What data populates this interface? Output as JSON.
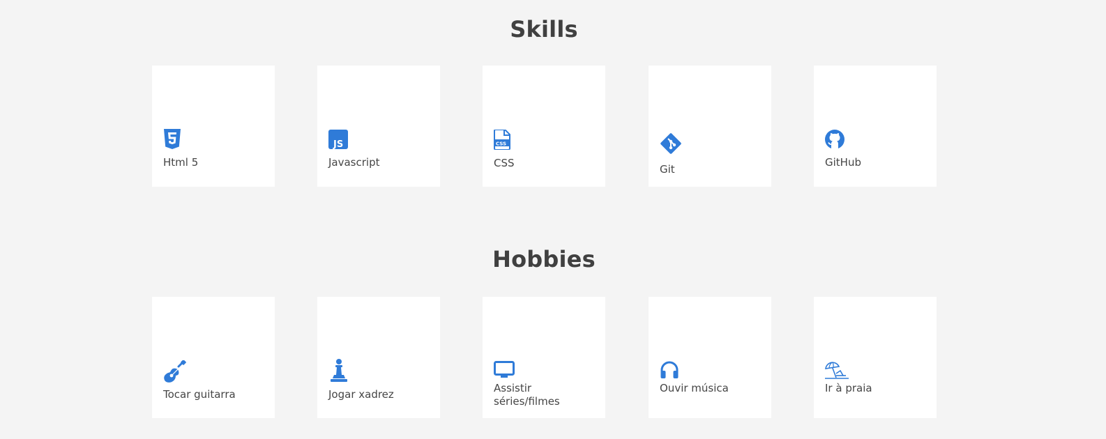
{
  "skills": {
    "title": "Skills",
    "items": [
      {
        "label": "Html 5",
        "icon": "html5-icon"
      },
      {
        "label": "Javascript",
        "icon": "javascript-icon"
      },
      {
        "label": "CSS",
        "icon": "css-file-icon"
      },
      {
        "label": "Git",
        "icon": "git-icon"
      },
      {
        "label": "GitHub",
        "icon": "github-icon"
      }
    ]
  },
  "hobbies": {
    "title": "Hobbies",
    "items": [
      {
        "label": "Tocar guitarra",
        "icon": "guitar-icon"
      },
      {
        "label": "Jogar xadrez",
        "icon": "chess-pawn-icon"
      },
      {
        "label": "Assistir séries/filmes",
        "icon": "tv-icon"
      },
      {
        "label": "Ouvir música",
        "icon": "headphones-icon"
      },
      {
        "label": "Ir à praia",
        "icon": "beach-umbrella-icon"
      }
    ]
  },
  "colors": {
    "background": "#f4f4f4",
    "card": "#ffffff",
    "accent": "#2f7bd8",
    "text": "#454545"
  }
}
